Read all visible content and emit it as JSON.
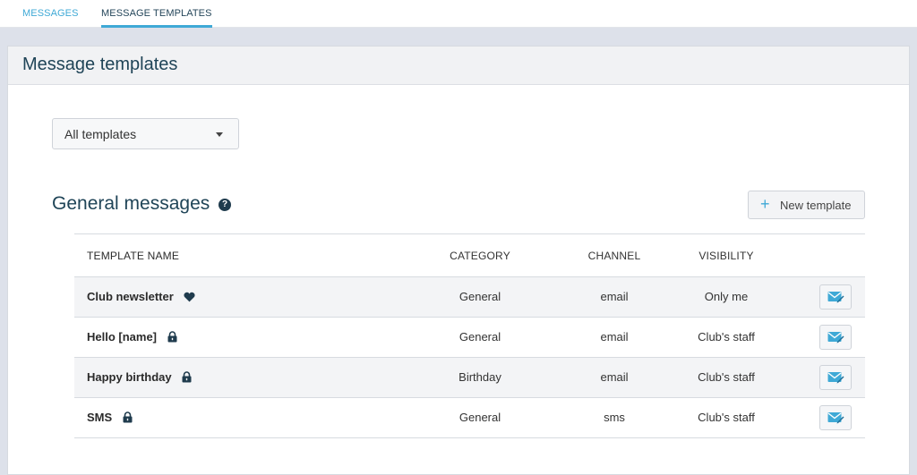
{
  "tabs": {
    "messages": "MESSAGES",
    "templates": "MESSAGE TEMPLATES"
  },
  "panel": {
    "title": "Message templates"
  },
  "filter": {
    "selected": "All templates"
  },
  "section": {
    "title": "General messages",
    "help_icon": "question-circle-icon",
    "new_template_label": "New template"
  },
  "table": {
    "headers": {
      "name": "TEMPLATE NAME",
      "category": "CATEGORY",
      "channel": "CHANNEL",
      "visibility": "VISIBILITY"
    },
    "rows": [
      {
        "name": "Club newsletter",
        "icon": "heart-icon",
        "category": "General",
        "channel": "email",
        "visibility": "Only me"
      },
      {
        "name": "Hello [name]",
        "icon": "lock-icon",
        "category": "General",
        "channel": "email",
        "visibility": "Club's staff"
      },
      {
        "name": "Happy birthday",
        "icon": "lock-icon",
        "category": "Birthday",
        "channel": "email",
        "visibility": "Club's staff"
      },
      {
        "name": "SMS",
        "icon": "lock-icon",
        "category": "General",
        "channel": "sms",
        "visibility": "Club's staff"
      }
    ]
  },
  "colors": {
    "accent": "#3fa9d6",
    "title": "#1f4457",
    "icon_dark": "#1f3b4d"
  }
}
